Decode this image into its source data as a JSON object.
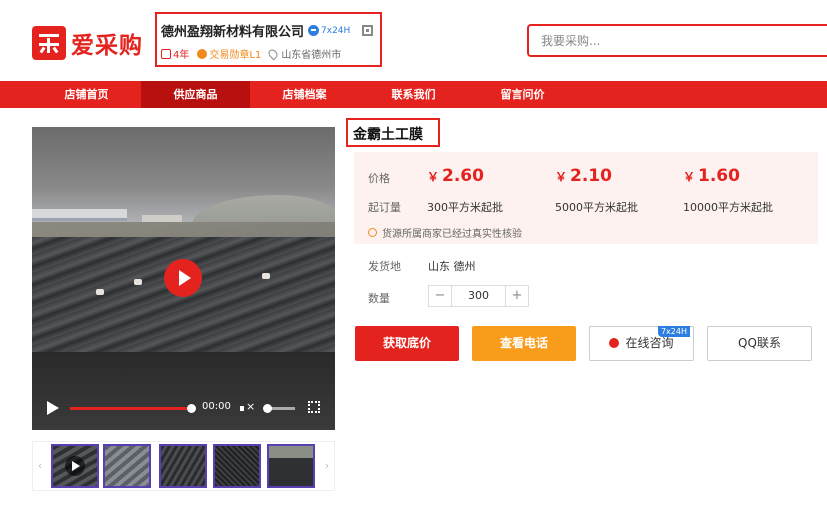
{
  "header": {
    "logo_text": "爱采购",
    "shop": {
      "name": "德州盈翔新材料有限公司",
      "service_badge": "7x24H",
      "years": "4年",
      "trade_badge": "交易勋章L1",
      "location": "山东省德州市"
    },
    "search_placeholder": "我要采购..."
  },
  "nav": {
    "items": [
      "店铺首页",
      "供应商品",
      "店铺档案",
      "联系我们",
      "留言问价"
    ],
    "active_index": 1
  },
  "video": {
    "time": "00:00"
  },
  "product": {
    "title": "金霸土工膜",
    "price_label": "价格",
    "currency": "￥",
    "prices": [
      "2.60",
      "2.10",
      "1.60"
    ],
    "moq_label": "起订量",
    "moqs": [
      "300平方米起批",
      "5000平方米起批",
      "10000平方米起批"
    ],
    "verify_text": "货源所属商家已经过真实性核验",
    "ship_label": "发货地",
    "ship_value": "山东 德州",
    "qty_label": "数量",
    "qty_value": "300",
    "qty_minus": "−",
    "qty_plus": "+"
  },
  "actions": {
    "get_price": "获取底价",
    "view_phone": "查看电话",
    "online_chat": "在线咨询",
    "chat_tag": "7x24H",
    "qq": "QQ联系"
  },
  "thumbs": {
    "prev": "‹",
    "next": "›"
  },
  "colors": {
    "brand_red": "#e4231e",
    "nav_active": "#b8100f",
    "orange": "#f99c1c",
    "price_bg": "#fdf2ef"
  }
}
